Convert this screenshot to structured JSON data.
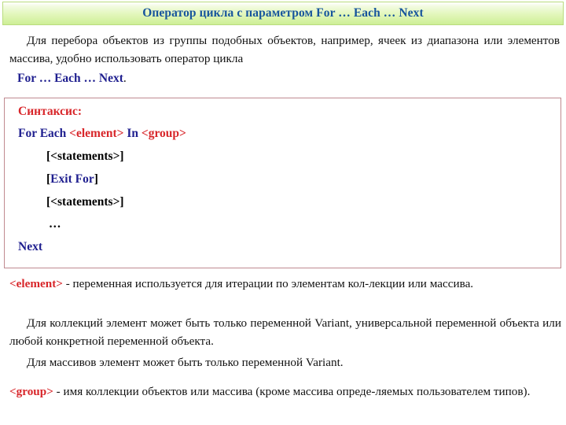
{
  "slide": {
    "header": {
      "title": "Оператор цикла с параметром For … Each … Next",
      "title_color": "#17559c",
      "band_color_top": "#ffffff",
      "band_color_bottom": "#cdee96",
      "border_color": "#b9dc7e"
    },
    "intro": {
      "text": "Для перебора объектов из группы подобных объектов, например, ячеек из диапазона или элементов массива, удобно использовать оператор цикла",
      "statement_name": "For … Each … Next",
      "statement_trailing": "."
    },
    "syntax_box": {
      "border_color": "#c08a90",
      "title": "Синтаксис:",
      "title_color": "#d8262a",
      "lines": [
        {
          "id": "header-line",
          "parts": [
            {
              "text": "For Each ",
              "style": "blue"
            },
            {
              "text": "<element>",
              "style": "red"
            },
            {
              "text": " In ",
              "style": "blue"
            },
            {
              "text": "<group>",
              "style": "red"
            }
          ]
        },
        {
          "id": "statements-1",
          "parts": [
            {
              "text": "[<statements>]",
              "style": "black"
            }
          ]
        },
        {
          "id": "exit-for",
          "parts": [
            {
              "text": "[",
              "style": "black"
            },
            {
              "text": "Exit For",
              "style": "blue"
            },
            {
              "text": "]",
              "style": "black"
            }
          ]
        },
        {
          "id": "statements-2",
          "parts": [
            {
              "text": "[<statements>]",
              "style": "black"
            }
          ]
        },
        {
          "id": "ellipsis",
          "parts": [
            {
              "text": "…",
              "style": "black"
            }
          ]
        },
        {
          "id": "next",
          "parts": [
            {
              "text": "Next",
              "style": "blue"
            }
          ]
        }
      ]
    },
    "explanations": [
      {
        "id": "element",
        "keyword": "<element>",
        "keyword_color": "#d8262a",
        "text": " - переменная используется для итерации по элементам кол-лекции или массива."
      },
      {
        "id": "collections",
        "keyword": "",
        "text": "Для коллекций элемент может быть только переменной Variant, универсальной переменной объекта или любой конкретной переменной объекта."
      },
      {
        "id": "arrays",
        "keyword": "",
        "text": "Для массивов элемент может быть только переменной Variant."
      },
      {
        "id": "group",
        "keyword": "<group>",
        "keyword_color": "#d8262a",
        "text": " - имя коллекции объектов или массива (кроме массива опреде-ляемых пользователем типов)."
      }
    ]
  }
}
